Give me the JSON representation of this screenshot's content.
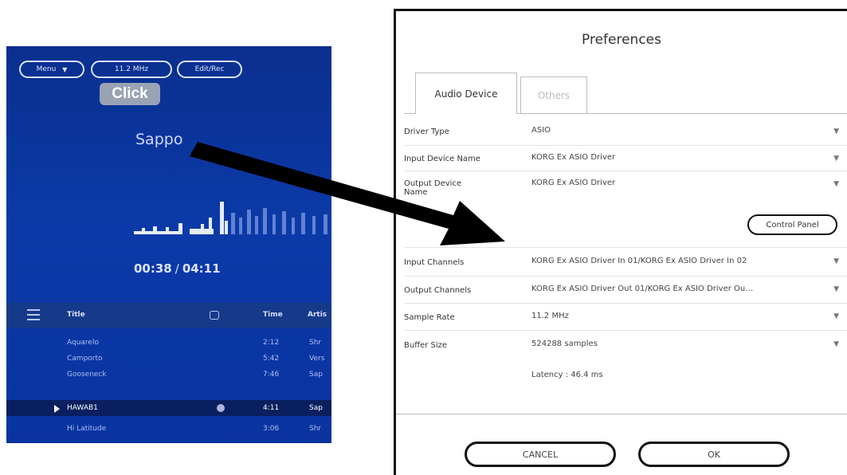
{
  "player": {
    "menu_label": "Menu",
    "rate_label": "11.2 MHz",
    "edit_label": "Edit/Rec",
    "click_label": "Click",
    "track_name": "Sappo",
    "elapsed": "00:38",
    "separator": "/",
    "total": "04:11",
    "columns": {
      "title": "Title",
      "time": "Time",
      "artist": "Artis"
    },
    "rows": [
      {
        "title": "Aquarelo",
        "time": "2:12",
        "artist": "Shr"
      },
      {
        "title": "Camporto",
        "time": "5:42",
        "artist": "Vers"
      },
      {
        "title": "Gooseneck",
        "time": "7:46",
        "artist": "Sap"
      },
      {
        "title": "HAWAB1",
        "time": "4:11",
        "artist": "Sap"
      },
      {
        "title": "Hi Latitude",
        "time": "3:06",
        "artist": "Shr"
      }
    ]
  },
  "dialog": {
    "title": "Preferences",
    "tabs": {
      "audio": "Audio Device",
      "others": "Others"
    },
    "rows": {
      "driver_type": {
        "label": "Driver Type",
        "value": "ASIO"
      },
      "input_device": {
        "label": "Input Device Name",
        "value": "KORG Ex ASIO Driver"
      },
      "output_device": {
        "label": "Output Device Name",
        "value": "KORG Ex ASIO Driver"
      },
      "input_channels": {
        "label": "Input Channels",
        "value": "KORG Ex ASIO Driver In 01/KORG Ex ASIO Driver In 02"
      },
      "output_channels": {
        "label": "Output Channels",
        "value": "KORG Ex ASIO Driver Out 01/KORG Ex ASIO Driver Ou…"
      },
      "sample_rate": {
        "label": "Sample Rate",
        "value": "11.2 MHz"
      },
      "buffer_size": {
        "label": "Buffer Size",
        "value": "524288 samples"
      }
    },
    "control_panel_label": "Control Panel",
    "latency": "Latency : 46.4 ms",
    "cancel_label": "CANCEL",
    "ok_label": "OK",
    "dropdown_glyph": "▼"
  }
}
